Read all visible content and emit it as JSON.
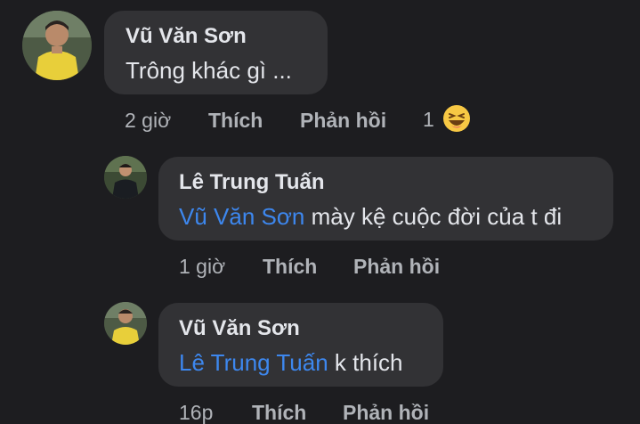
{
  "comments": [
    {
      "author": "Vũ Văn Sơn",
      "text": "Trông khác gì ...",
      "time": "2 giờ",
      "like": "Thích",
      "reply": "Phản hồi",
      "reaction_count": "1",
      "reaction_icon": "haha-emoji-icon"
    },
    {
      "author": "Lê Trung Tuấn",
      "mention": "Vũ Văn Sơn",
      "text": " mày kệ cuộc đời của t đi",
      "time": "1 giờ",
      "like": "Thích",
      "reply": "Phản hồi"
    },
    {
      "author": "Vũ Văn Sơn",
      "mention": "Lê Trung Tuấn",
      "text": " k thích",
      "time": "16p",
      "like": "Thích",
      "reply": "Phản hồi"
    }
  ],
  "colors": {
    "background": "#1d1d20",
    "bubble": "#323235",
    "mention": "#3d87ee",
    "meta": "#b0b3b8",
    "text": "#e4e6eb"
  }
}
